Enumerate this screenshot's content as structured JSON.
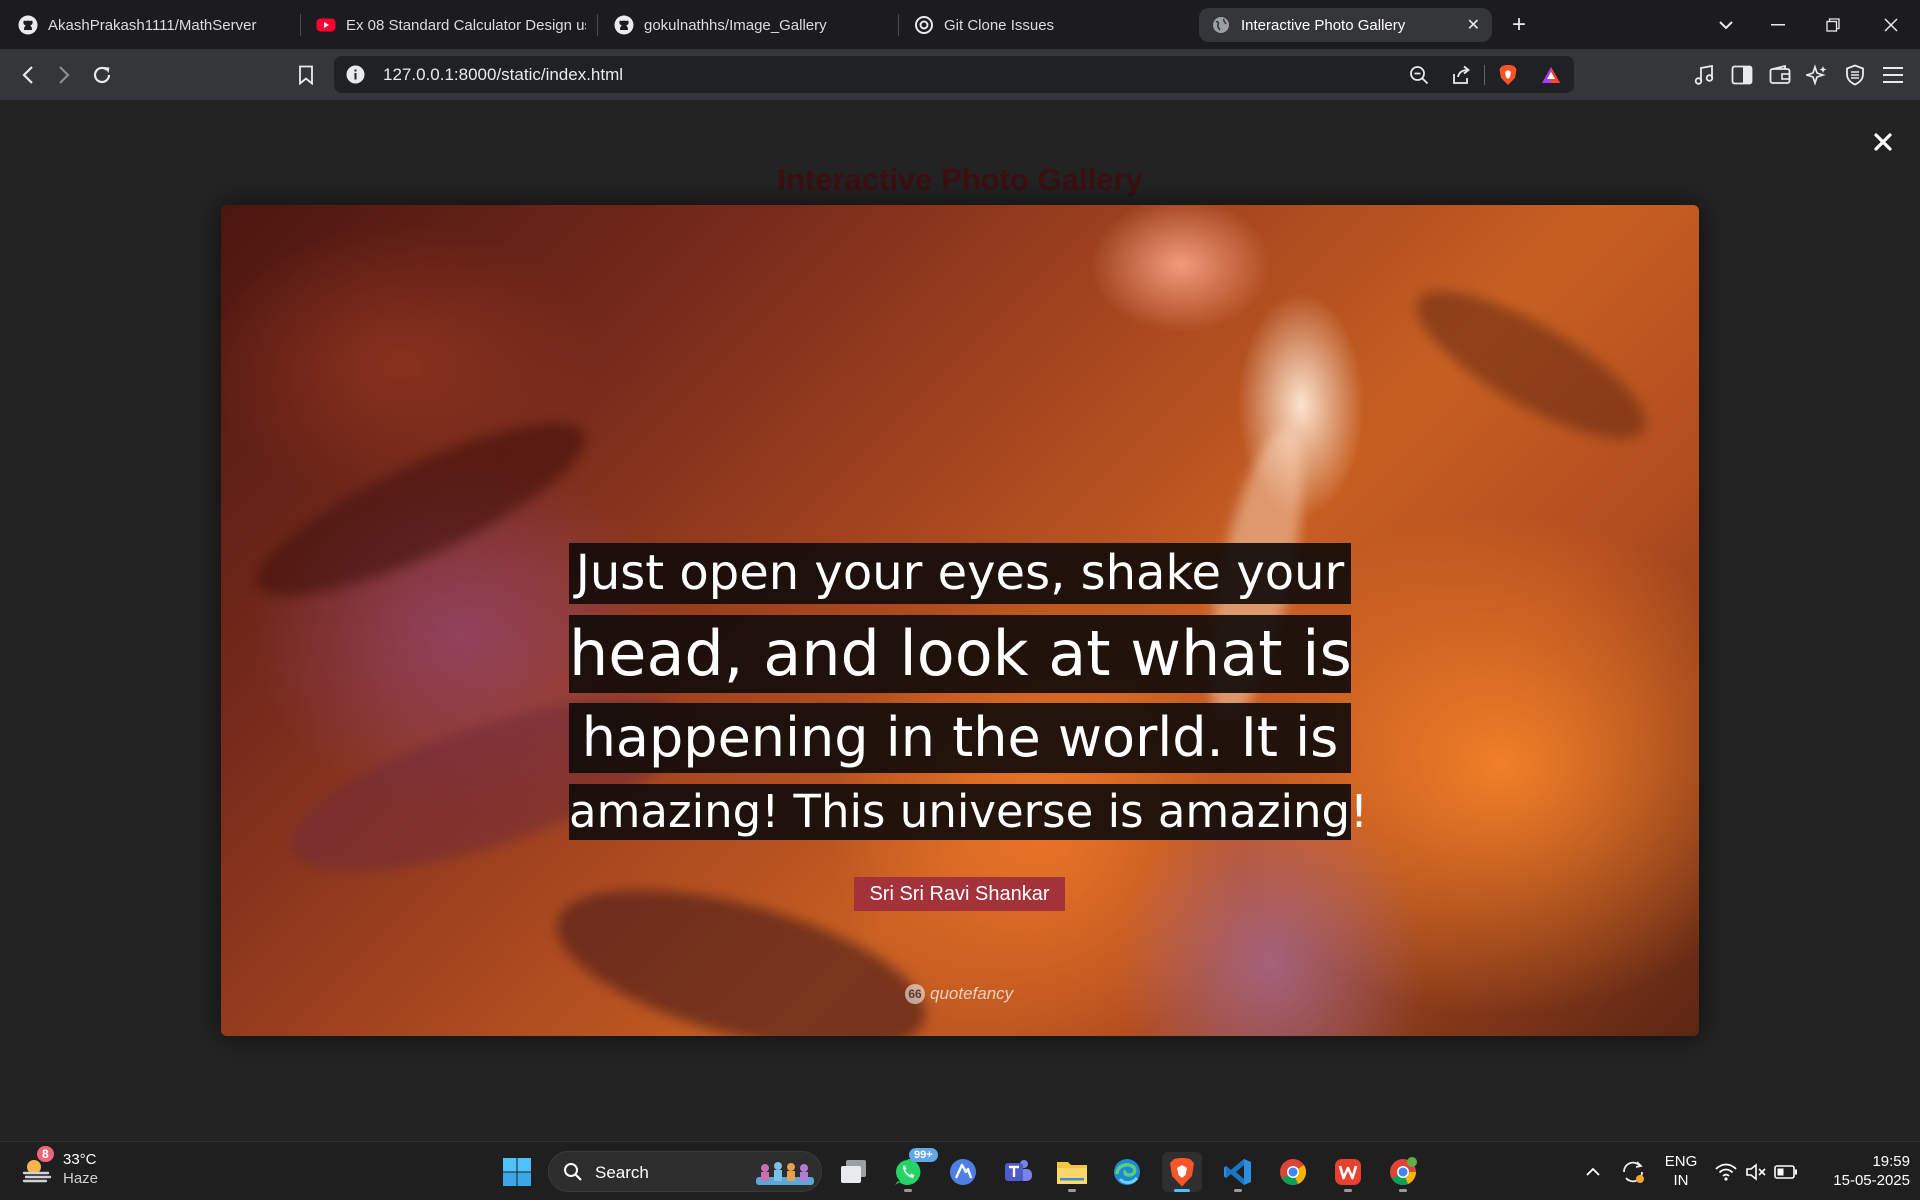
{
  "browser": {
    "tabs": [
      {
        "title": "AkashPrakash1111/MathServer",
        "icon": "github-icon"
      },
      {
        "title": "Ex 08 Standard Calculator Design us",
        "icon": "youtube-icon"
      },
      {
        "title": "gokulnathhs/Image_Gallery",
        "icon": "github-icon"
      },
      {
        "title": "Git Clone Issues",
        "icon": "openai-icon"
      },
      {
        "title": "Interactive Photo Gallery",
        "icon": "globe-icon",
        "active": true
      }
    ],
    "url": "127.0.0.1:8000/static/index.html"
  },
  "page": {
    "title": "Interactive Photo Gallery",
    "close_symbol": "✕",
    "image": {
      "quote_lines": [
        "Just open your eyes, shake your",
        "head, and look at what is",
        "happening in the world. It is",
        "amazing! This universe is amazing!"
      ],
      "author": "Sri Sri Ravi Shankar",
      "brand": "quotefancy",
      "brand_glyph": "66"
    }
  },
  "taskbar": {
    "weather": {
      "temp": "33°C",
      "condition": "Haze",
      "badge": "8"
    },
    "search_label": "Search",
    "whatsapp_badge": "99+",
    "language": {
      "line1": "ENG",
      "line2": "IN"
    },
    "clock": {
      "time": "19:59",
      "date": "15-05-2025"
    }
  },
  "colors": {
    "page_bg": "#232323",
    "title": "#3d0f12",
    "author_bg": "#a4323b",
    "accent": "#4cc2ff"
  }
}
